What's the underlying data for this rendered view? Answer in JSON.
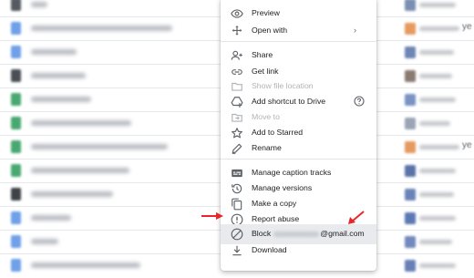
{
  "menu": {
    "preview": "Preview",
    "open_with": "Open with",
    "open_with_chevron": "›",
    "share": "Share",
    "get_link": "Get link",
    "show_file_location": "Show file location",
    "add_shortcut": "Add shortcut to Drive",
    "move_to": "Move to",
    "add_to_starred": "Add to Starred",
    "rename": "Rename",
    "manage_caption_tracks": "Manage caption tracks",
    "manage_versions": "Manage versions",
    "make_a_copy": "Make a copy",
    "report_abuse": "Report abuse",
    "block_prefix": "Block",
    "block_suffix": "@gmail.com",
    "download": "Download"
  },
  "files": {
    "owner_tail": "ye"
  },
  "colors": {
    "arrow_red": "#e8262a",
    "highlight": "#e8eaed",
    "icon_gray": "#5f6368",
    "disabled_gray": "#b0b3b8"
  },
  "icons": [
    "eye-icon",
    "move-arrows-icon",
    "add-person-icon",
    "link-icon",
    "folder-icon",
    "add-to-drive-icon",
    "help-circle-icon",
    "move-folder-icon",
    "star-icon",
    "pencil-icon",
    "caption-icon",
    "history-icon",
    "copy-icon",
    "report-icon",
    "block-icon",
    "download-icon"
  ]
}
